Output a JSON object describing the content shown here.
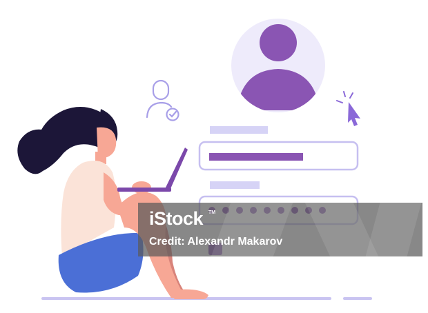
{
  "watermark": {
    "logo": "iStock",
    "trademark": "TM",
    "credit": "Credit: Alexandr Makarov"
  },
  "colors": {
    "purple": "#8a55b3",
    "lavender": "#d6d3f6",
    "avatar_bg": "#eeebfb",
    "field_border": "#c6bff0",
    "hair": "#1c1638",
    "skin": "#f7a795",
    "shirt": "#fbe3d8",
    "skirt": "#4b6fd6",
    "laptop": "#7b48aa",
    "floor": "#c9c4f1"
  },
  "icons": [
    "user-check-icon",
    "cursor-icon",
    "avatar-icon"
  ]
}
